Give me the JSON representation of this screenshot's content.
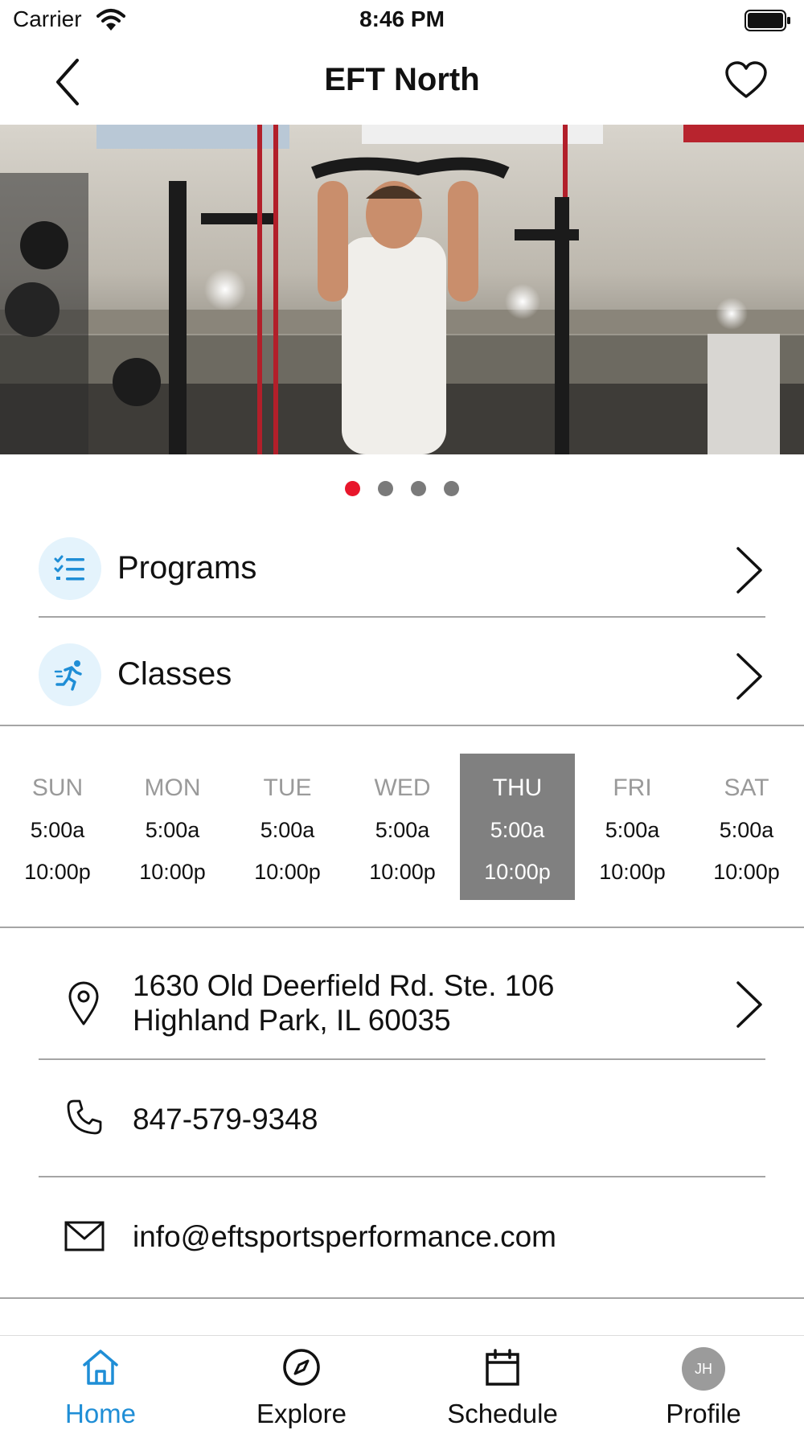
{
  "status_bar": {
    "carrier": "Carrier",
    "time": "8:46 PM"
  },
  "nav": {
    "title": "EFT North"
  },
  "carousel": {
    "total_slides": 4,
    "active_index": 0,
    "accent_color": "#e8162b"
  },
  "menu": {
    "programs": {
      "label": "Programs",
      "icon": "checklist-icon"
    },
    "classes": {
      "label": "Classes",
      "icon": "running-person-icon"
    }
  },
  "hours": {
    "days": [
      {
        "name": "SUN",
        "open": "5:00a",
        "close": "10:00p"
      },
      {
        "name": "MON",
        "open": "5:00a",
        "close": "10:00p"
      },
      {
        "name": "TUE",
        "open": "5:00a",
        "close": "10:00p"
      },
      {
        "name": "WED",
        "open": "5:00a",
        "close": "10:00p"
      },
      {
        "name": "THU",
        "open": "5:00a",
        "close": "10:00p"
      },
      {
        "name": "FRI",
        "open": "5:00a",
        "close": "10:00p"
      },
      {
        "name": "SAT",
        "open": "5:00a",
        "close": "10:00p"
      }
    ],
    "active_day": "THU"
  },
  "contact": {
    "address_line1": "1630 Old Deerfield Rd. Ste. 106",
    "address_line2": "Highland Park, IL 60035",
    "phone": "847-579-9348",
    "email": "info@eftsportsperformance.com"
  },
  "tabs": {
    "home": "Home",
    "explore": "Explore",
    "schedule": "Schedule",
    "profile": "Profile",
    "profile_initials": "JH",
    "active": "Home",
    "active_color": "#1f8ed6"
  }
}
